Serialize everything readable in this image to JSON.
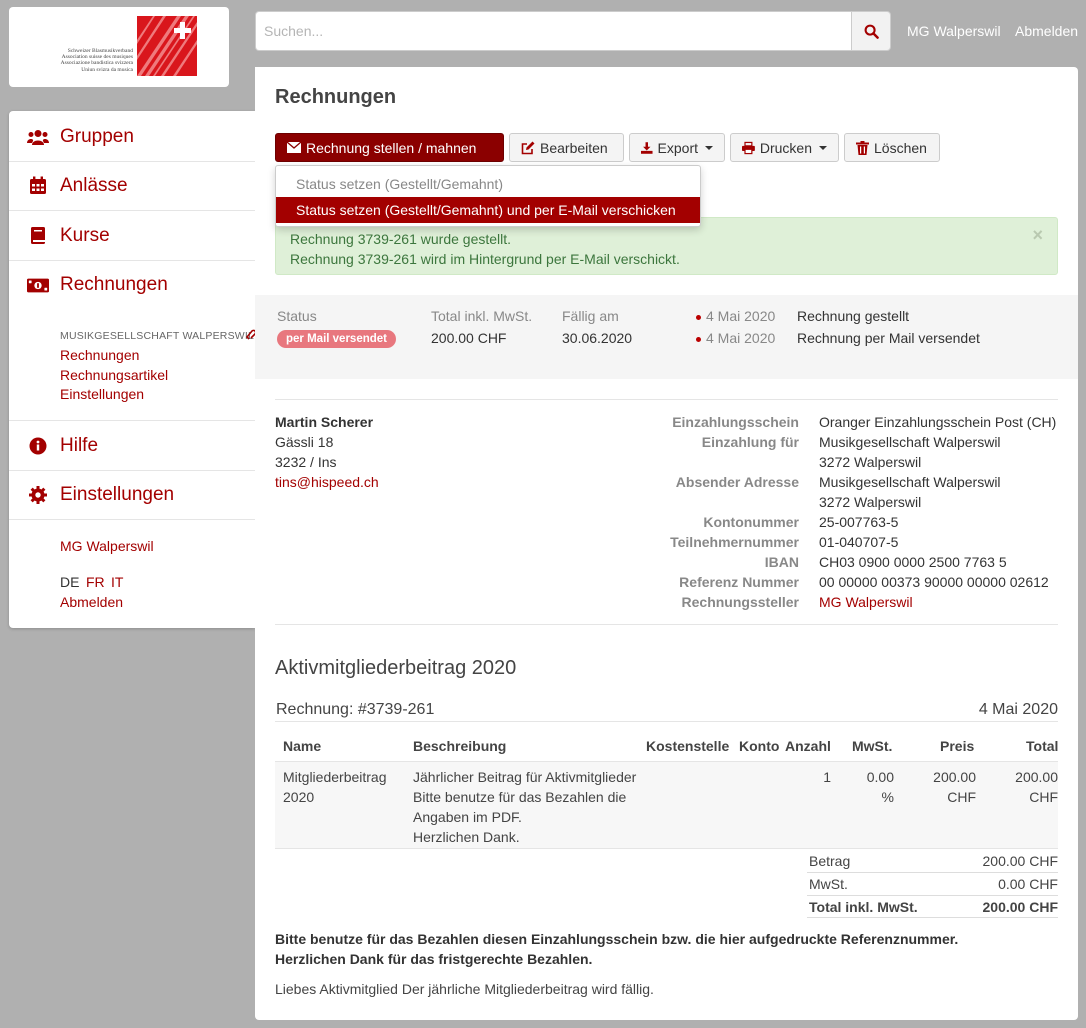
{
  "logo": {
    "lines": [
      "Schweizer Blasmusikverband",
      "Association suisse des musiques",
      "Associazione bandistica svizzera",
      "Uniun svizra da musica"
    ]
  },
  "search": {
    "placeholder": "Suchen..."
  },
  "top": {
    "user_link": "MG Walperswil",
    "logout_link": "Abmelden"
  },
  "sidebar": {
    "items": [
      {
        "label": "Gruppen",
        "icon": "users-icon"
      },
      {
        "label": "Anlässe",
        "icon": "calendar-icon"
      },
      {
        "label": "Kurse",
        "icon": "book-icon"
      },
      {
        "label": "Rechnungen",
        "icon": "money-bill-icon"
      },
      {
        "label": "Hilfe",
        "icon": "info-circle-icon"
      },
      {
        "label": "Einstellungen",
        "icon": "cog-icon"
      }
    ],
    "sub_header": "MUSIKGESELLSCHAFT WALPERSWIL",
    "sub_links": [
      "Rechnungen",
      "Rechnungsartikel",
      "Einstellungen"
    ],
    "group_link": "MG Walperswil",
    "languages": [
      "DE",
      "FR",
      "IT"
    ],
    "logout": "Abmelden"
  },
  "page": {
    "title": "Rechnungen"
  },
  "toolbar": {
    "send": "Rechnung stellen / mahnen",
    "edit": "Bearbeiten",
    "export": "Export",
    "print": "Drucken",
    "delete": "Löschen"
  },
  "dropdown": {
    "item1": "Status setzen (Gestellt/Gemahnt)",
    "item2": "Status setzen (Gestellt/Gemahnt) und per E-Mail verschicken"
  },
  "alert": {
    "line1": "Rechnung 3739-261 wurde gestellt.",
    "line2": "Rechnung 3739-261 wird im Hintergrund per E-Mail verschickt.",
    "close": "×"
  },
  "status_panel": {
    "status_label": "Status",
    "status_badge": "per Mail versendet",
    "total_label": "Total inkl. MwSt.",
    "total_value": "200.00 CHF",
    "due_label": "Fällig am",
    "due_value": "30.06.2020",
    "history": [
      {
        "date": "4 Mai 2020",
        "text": "Rechnung gestellt"
      },
      {
        "date": "4 Mai 2020",
        "text": "Rechnung per Mail versendet"
      }
    ]
  },
  "recipient": {
    "name": "Martin Scherer",
    "street": "Gässli 18",
    "city": "3232 / Ins",
    "email": "tins@hispeed.ch"
  },
  "details": {
    "einzahlungsschein_label": "Einzahlungsschein",
    "einzahlungsschein": "Oranger Einzahlungsschein Post (CH)",
    "einzahlung_fuer_label": "Einzahlung für",
    "einzahlung_fuer_1": "Musikgesellschaft Walperswil",
    "einzahlung_fuer_2": "3272 Walperswil",
    "absender_label": "Absender Adresse",
    "absender_1": "Musikgesellschaft Walperswil",
    "absender_2": "3272 Walperswil",
    "konto_label": "Kontonummer",
    "konto": "25-007763-5",
    "teilnehmer_label": "Teilnehmernummer",
    "teilnehmer": "01-040707-5",
    "iban_label": "IBAN",
    "iban": "CH03 0900 0000 2500 7763 5",
    "referenz_label": "Referenz Nummer",
    "referenz": "00 00000 00373 90000 00000 02612",
    "steller_label": "Rechnungssteller",
    "steller": "MG Walperswil"
  },
  "invoice": {
    "title": "Aktivmitgliederbeitrag 2020",
    "number": "Rechnung: #3739-261",
    "date": "4 Mai 2020",
    "headers": {
      "name": "Name",
      "beschreibung": "Beschreibung",
      "kostenstelle": "Kostenstelle",
      "konto": "Konto",
      "anzahl": "Anzahl",
      "mwst": "MwSt.",
      "preis": "Preis",
      "total": "Total"
    },
    "row": {
      "name_1": "Mitgliederbeitrag",
      "name_2": "2020",
      "desc_1": "Jährlicher Beitrag für Aktivmitglieder",
      "desc_2": "Bitte benutze für das Bezahlen die",
      "desc_3": "Angaben im PDF.",
      "desc_4": "Herzlichen Dank.",
      "anzahl": "1",
      "mwst_1": "0.00",
      "mwst_2": "%",
      "preis_1": "200.00",
      "preis_2": "CHF",
      "total_1": "200.00",
      "total_2": "CHF"
    },
    "totals": {
      "betrag_label": "Betrag",
      "betrag": "200.00 CHF",
      "mwst_label": "MwSt.",
      "mwst": "0.00 CHF",
      "total_label": "Total inkl. MwSt.",
      "total": "200.00 CHF"
    },
    "footer_bold_1": "Bitte benutze für das Bezahlen diesen Einzahlungsschein bzw. die hier aufgedruckte Referenznummer.",
    "footer_bold_2": "Herzlichen Dank für das fristgerechte Bezahlen.",
    "footer_text": "Liebes Aktivmitglied Der jährliche Mitgliederbeitrag wird fällig."
  }
}
